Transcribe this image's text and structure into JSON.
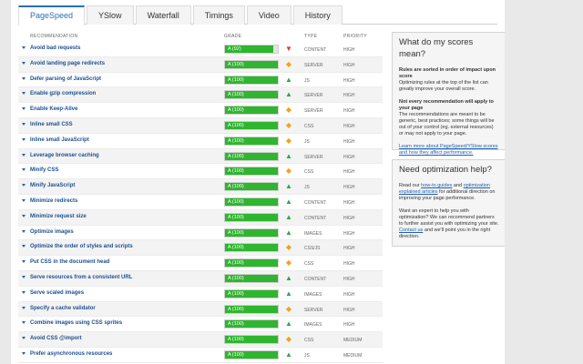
{
  "tabs": [
    {
      "label": "PageSpeed",
      "active": true
    },
    {
      "label": "YSlow",
      "active": false
    },
    {
      "label": "Waterfall",
      "active": false
    },
    {
      "label": "Timings",
      "active": false
    },
    {
      "label": "Video",
      "active": false
    },
    {
      "label": "History",
      "active": false
    }
  ],
  "columns": {
    "recommendation": "RECOMMENDATION",
    "grade": "GRADE",
    "type": "TYPE",
    "priority": "PRIORITY"
  },
  "rows": [
    {
      "name": "Avoid bad requests",
      "grade": "A (92)",
      "score": 92,
      "trend": "down",
      "type": "CONTENT",
      "priority": "HIGH"
    },
    {
      "name": "Avoid landing page redirects",
      "grade": "A (100)",
      "score": 100,
      "trend": "neutral",
      "type": "SERVER",
      "priority": "HIGH"
    },
    {
      "name": "Defer parsing of JavaScript",
      "grade": "A (100)",
      "score": 100,
      "trend": "up",
      "type": "JS",
      "priority": "HIGH"
    },
    {
      "name": "Enable gzip compression",
      "grade": "A (100)",
      "score": 100,
      "trend": "up",
      "type": "SERVER",
      "priority": "HIGH"
    },
    {
      "name": "Enable Keep-Alive",
      "grade": "A (100)",
      "score": 100,
      "trend": "neutral",
      "type": "SERVER",
      "priority": "HIGH"
    },
    {
      "name": "Inline small CSS",
      "grade": "A (100)",
      "score": 100,
      "trend": "neutral",
      "type": "CSS",
      "priority": "HIGH"
    },
    {
      "name": "Inline small JavaScript",
      "grade": "A (100)",
      "score": 100,
      "trend": "neutral",
      "type": "JS",
      "priority": "HIGH"
    },
    {
      "name": "Leverage browser caching",
      "grade": "A (100)",
      "score": 100,
      "trend": "up",
      "type": "SERVER",
      "priority": "HIGH"
    },
    {
      "name": "Minify CSS",
      "grade": "A (100)",
      "score": 100,
      "trend": "neutral",
      "type": "CSS",
      "priority": "HIGH"
    },
    {
      "name": "Minify JavaScript",
      "grade": "A (100)",
      "score": 100,
      "trend": "up",
      "type": "JS",
      "priority": "HIGH"
    },
    {
      "name": "Minimize redirects",
      "grade": "A (100)",
      "score": 100,
      "trend": "up",
      "type": "CONTENT",
      "priority": "HIGH"
    },
    {
      "name": "Minimize request size",
      "grade": "A (100)",
      "score": 100,
      "trend": "up",
      "type": "CONTENT",
      "priority": "HIGH"
    },
    {
      "name": "Optimize images",
      "grade": "A (100)",
      "score": 100,
      "trend": "up",
      "type": "IMAGES",
      "priority": "HIGH"
    },
    {
      "name": "Optimize the order of styles and scripts",
      "grade": "A (100)",
      "score": 100,
      "trend": "neutral",
      "type": "CSS/JS",
      "priority": "HIGH"
    },
    {
      "name": "Put CSS in the document head",
      "grade": "A (100)",
      "score": 100,
      "trend": "neutral",
      "type": "CSS",
      "priority": "HIGH"
    },
    {
      "name": "Serve resources from a consistent URL",
      "grade": "A (100)",
      "score": 100,
      "trend": "up",
      "type": "CONTENT",
      "priority": "HIGH"
    },
    {
      "name": "Serve scaled images",
      "grade": "A (100)",
      "score": 100,
      "trend": "up",
      "type": "IMAGES",
      "priority": "HIGH"
    },
    {
      "name": "Specify a cache validator",
      "grade": "A (100)",
      "score": 100,
      "trend": "neutral",
      "type": "SERVER",
      "priority": "HIGH"
    },
    {
      "name": "Combine images using CSS sprites",
      "grade": "A (100)",
      "score": 100,
      "trend": "up",
      "type": "IMAGES",
      "priority": "HIGH"
    },
    {
      "name": "Avoid CSS @import",
      "grade": "A (100)",
      "score": 100,
      "trend": "neutral",
      "type": "CSS",
      "priority": "MEDIUM"
    },
    {
      "name": "Prefer asynchronous resources",
      "grade": "A (100)",
      "score": 100,
      "trend": "up",
      "type": "JS",
      "priority": "MEDIUM"
    }
  ],
  "panel_scores": {
    "title": "What do my scores mean?",
    "bold1": "Rules are sorted in order of impact upon score",
    "text1": "Optimizing rules at the top of the list can greatly improve your overall score.",
    "bold2": "Not every recommendation will apply to your page",
    "text2": "The recommendations are meant to be generic, best practices; some things will be out of your control (eg. external resources) or may not apply to your page.",
    "link": "Learn more about PageSpeed/YSlow scores and how they affect performance."
  },
  "panel_help": {
    "title": "Need optimization help?",
    "p1_pre": "Read our ",
    "p1_link1": "how-to guides",
    "p1_mid": " and ",
    "p1_link2": "optimization explained articles",
    "p1_post": " for additional direction on improving your page performance.",
    "p2_pre": "Want an expert to help you with optimization? We can recommend partners to further assist you with optimizing your site. ",
    "p2_link": "Contact us",
    "p2_post": " and we'll point you in the right direction."
  },
  "colors": {
    "grade_fill": "#2fb52f",
    "accent": "#2b6fb3",
    "up": "#2fa64a",
    "neutral": "#f0a31b",
    "down": "#d63b3b"
  }
}
